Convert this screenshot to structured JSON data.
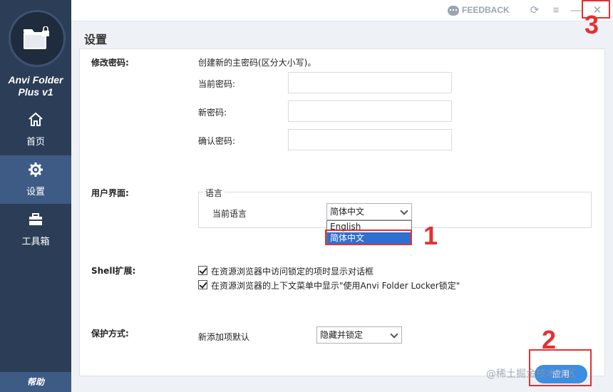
{
  "app": {
    "name": "Anvi Folder Plus v1"
  },
  "sidebar": {
    "items": [
      {
        "label": "首页",
        "icon": "home-icon"
      },
      {
        "label": "设置",
        "icon": "gear-icon"
      },
      {
        "label": "工具箱",
        "icon": "toolbox-icon"
      }
    ],
    "help_label": "帮助"
  },
  "topbar": {
    "feedback_label": "FEEDBACK"
  },
  "page": {
    "title": "设置"
  },
  "password": {
    "section_label": "修改密码:",
    "hint": "创建新的主密码(区分大小写)。",
    "current_label": "当前密码:",
    "new_label": "新密码:",
    "confirm_label": "确认密码:"
  },
  "ui_section": {
    "section_label": "用户界面:",
    "group_title": "语言",
    "lang_label": "当前语言",
    "lang_value": "简体中文",
    "options": [
      "English",
      "简体中文"
    ]
  },
  "shell": {
    "section_label": "Shell扩展:",
    "options": [
      {
        "label": "在资源浏览器中访问锁定的项时显示对话框",
        "checked": true
      },
      {
        "label": "在资源浏览器的上下文菜单中显示\"使用Anvi Folder Locker锁定\"",
        "checked": true
      }
    ]
  },
  "protection": {
    "section_label": "保护方式:",
    "default_label": "新添加项默认",
    "default_value": "隐藏并锁定"
  },
  "apply_label": "应用",
  "annotations": {
    "one": "1",
    "two": "2",
    "three": "3"
  },
  "watermark": "@稀土掘金技术社区",
  "colors": {
    "sidebar": "#2c3e57",
    "active": "#3d5b84",
    "accent": "#3d8de0",
    "annotation": "#e53030"
  }
}
